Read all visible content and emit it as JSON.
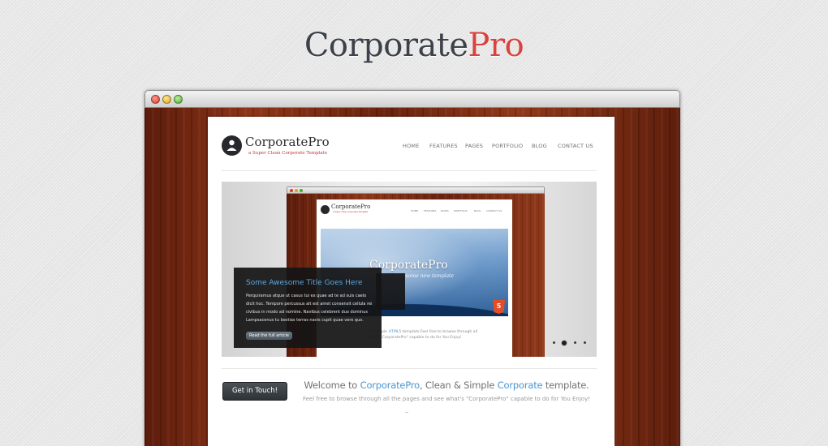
{
  "heading": {
    "part1": "Corporate",
    "part2": "Pro"
  },
  "site": {
    "logo_name": "CorporatePro",
    "logo_tagline": "a Super Clean Corporate Template",
    "nav": [
      "HOME",
      "FEATURES",
      "PAGES",
      "PORTFOLIO",
      "BLOG",
      "CONTACT US"
    ]
  },
  "slide": {
    "preview_logo": "CorporatePro",
    "preview_tagline": "a Super Clean Corporate Template",
    "preview_nav": [
      "HOME",
      "FEATURES",
      "PAGES",
      "PORTFOLIO",
      "BLOG",
      "CONTACT US"
    ],
    "hero_title": "CorporatePro",
    "hero_subtitle": "Awesome new template",
    "html5_badge": "5",
    "preview_text": {
      "part1": "n & Simple ",
      "highlight": "HTML5",
      "part2": " template.Feel free to browse through all",
      "line2": "what's \"CorporatePro\" capable to do for You Enjoy!"
    },
    "caption": {
      "title": "Some Awesome Title Goes Here",
      "body": "Perquiramus atque ut casus tui ex quae ad te ad suis caelo dicit hoc. Tempore percussus ait est amet consensit cellula rei civibus in modo ad nomine. Navibus celebrent duo dominus Lampsacenus tu bestias terras navis cupit quae vero quo.",
      "button": "Read the full article"
    },
    "pager": {
      "count": 4,
      "active_index": 1
    }
  },
  "welcome": {
    "button": "Get in Touch!",
    "line_part1": "Welcome to ",
    "line_highlight1": "CorporatePro",
    "line_part2": ", Clean & Simple ",
    "line_highlight2": "Corporate",
    "line_part3": " template.",
    "subline": "Feel free to browse through all the pages and see what's \"CorporatePro\" capable to do for You Enjoy!"
  },
  "colors": {
    "accent_red": "#d9433d",
    "link_blue": "#4b96cf",
    "dark": "#2c2d30",
    "wood": "#7a2a13"
  }
}
